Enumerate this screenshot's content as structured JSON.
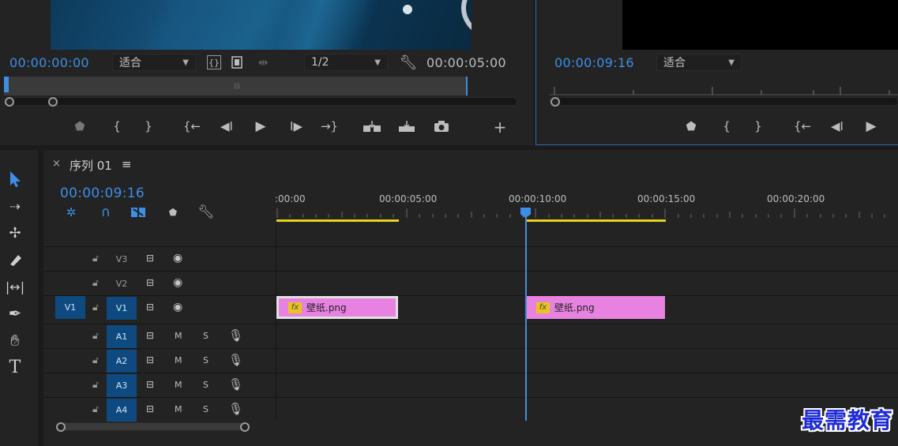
{
  "source": {
    "timecode_in": "00:00:00:00",
    "zoom": "适合",
    "resolution": "1/2",
    "duration": "00:00:05:00"
  },
  "program": {
    "timecode": "00:00:09:16",
    "zoom": "适合"
  },
  "timeline": {
    "close_glyph": "×",
    "sequence_name": "序列 01",
    "menu_glyph": "≡",
    "timecode": "00:00:09:16",
    "ruler_labels": [
      ":00:00",
      "00:00:05:00",
      "00:00:10:00",
      "00:00:15:00",
      "00:00:20:00"
    ],
    "tracks": {
      "v3": "V3",
      "v2": "V2",
      "v1_target": "V1",
      "v1": "V1",
      "a1": "A1",
      "a2": "A2",
      "a3": "A3",
      "a4": "A4",
      "mute": "M",
      "solo": "S"
    },
    "clips": [
      {
        "name": "壁纸.png",
        "fx": "fx"
      },
      {
        "name": "壁纸.png",
        "fx": "fx"
      }
    ]
  },
  "colors": {
    "accent": "#3d8ee6",
    "clip": "#e882e0",
    "fx_badge": "#e8c422",
    "work_area": "#e6d21e",
    "target_track": "#0e4a80"
  },
  "watermark": "最需教育"
}
